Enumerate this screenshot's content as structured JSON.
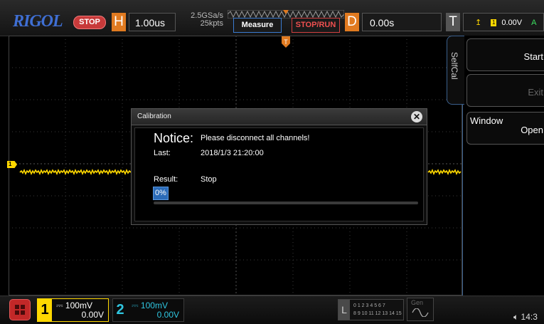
{
  "topbar": {
    "logo": "RIGOL",
    "run_state": "STOP",
    "horizontal_label": "H",
    "timebase": "1.00us",
    "sample_rate": "2.5GSa/s",
    "memory_depth": "25kpts",
    "measure_label": "Measure",
    "stop_run_label": "STOP/RUN",
    "delay_label": "D",
    "delay": "0.00s",
    "trigger_label": "T",
    "trigger_channel": "1",
    "trigger_level": "0.00V",
    "trigger_mode": "A"
  },
  "side_menu": {
    "tab_label": "SelfCal",
    "items": [
      {
        "title": "",
        "label": "Start"
      },
      {
        "title": "",
        "label": "Exit"
      },
      {
        "title": "Window",
        "label": "Open"
      }
    ]
  },
  "dialog": {
    "title": "Calibration",
    "close_symbol": "✕",
    "notice_label": "Notice:",
    "notice_message": "Please disconnect all channels!",
    "last_label": "Last:",
    "last_value": "2018/1/3 21:20:00",
    "result_label": "Result:",
    "result_value": "Stop",
    "progress_text": "0%",
    "progress_fraction": 0
  },
  "bottombar": {
    "ch1": {
      "number": "1",
      "scale": "100mV",
      "offset": "0.00V"
    },
    "ch2": {
      "number": "2",
      "scale": "100mV",
      "offset": "0.00V"
    },
    "la": {
      "label": "L",
      "bits_row1": "0 1 2 3  4 5 6 7",
      "bits_row2": "8 9 10 11  12 13 14 15"
    },
    "gen_label": "Gen",
    "time": "14:3"
  },
  "markers": {
    "ch1_marker": "1",
    "trigger_marker": "T"
  },
  "colors": {
    "ch1": "#ffd800",
    "ch2": "#2fc6e0",
    "accent_orange": "#e07a20",
    "stop_red": "#c83a3a",
    "progress_blue": "#2b6bb8"
  }
}
